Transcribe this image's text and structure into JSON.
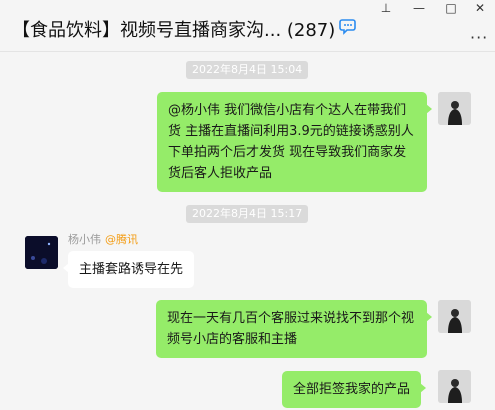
{
  "window": {
    "title": "【食品饮料】视频号直播商家沟... (287)",
    "pin_glyph": "⊥",
    "minimize_glyph": "—",
    "maximize_glyph": "□",
    "close_glyph": "✕",
    "more_glyph": "···"
  },
  "messages": [
    {
      "type": "time",
      "text": "2022年8月4日 15:04"
    },
    {
      "type": "msg",
      "side": "right",
      "text": "@杨小伟   我们微信小店有个达人在带我们货 主播在直播间利用3.9元的链接诱惑别人下单拍两个后才发货 现在导致我们商家发货后客人拒收产品"
    },
    {
      "type": "time",
      "text": "2022年8月4日 15:17"
    },
    {
      "type": "msg",
      "side": "left",
      "sender": "杨小伟",
      "org": "@腾讯",
      "text": "主播套路诱导在先"
    },
    {
      "type": "msg",
      "side": "right",
      "text": "现在一天有几百个客服过来说找不到那个视频号小店的客服和主播"
    },
    {
      "type": "msg",
      "side": "right",
      "text": "全部拒签我家的产品"
    }
  ],
  "colors": {
    "bubble_self": "#95ec69",
    "bubble_other": "#ffffff",
    "background": "#f5f5f5",
    "org_tag": "#f39c12"
  }
}
